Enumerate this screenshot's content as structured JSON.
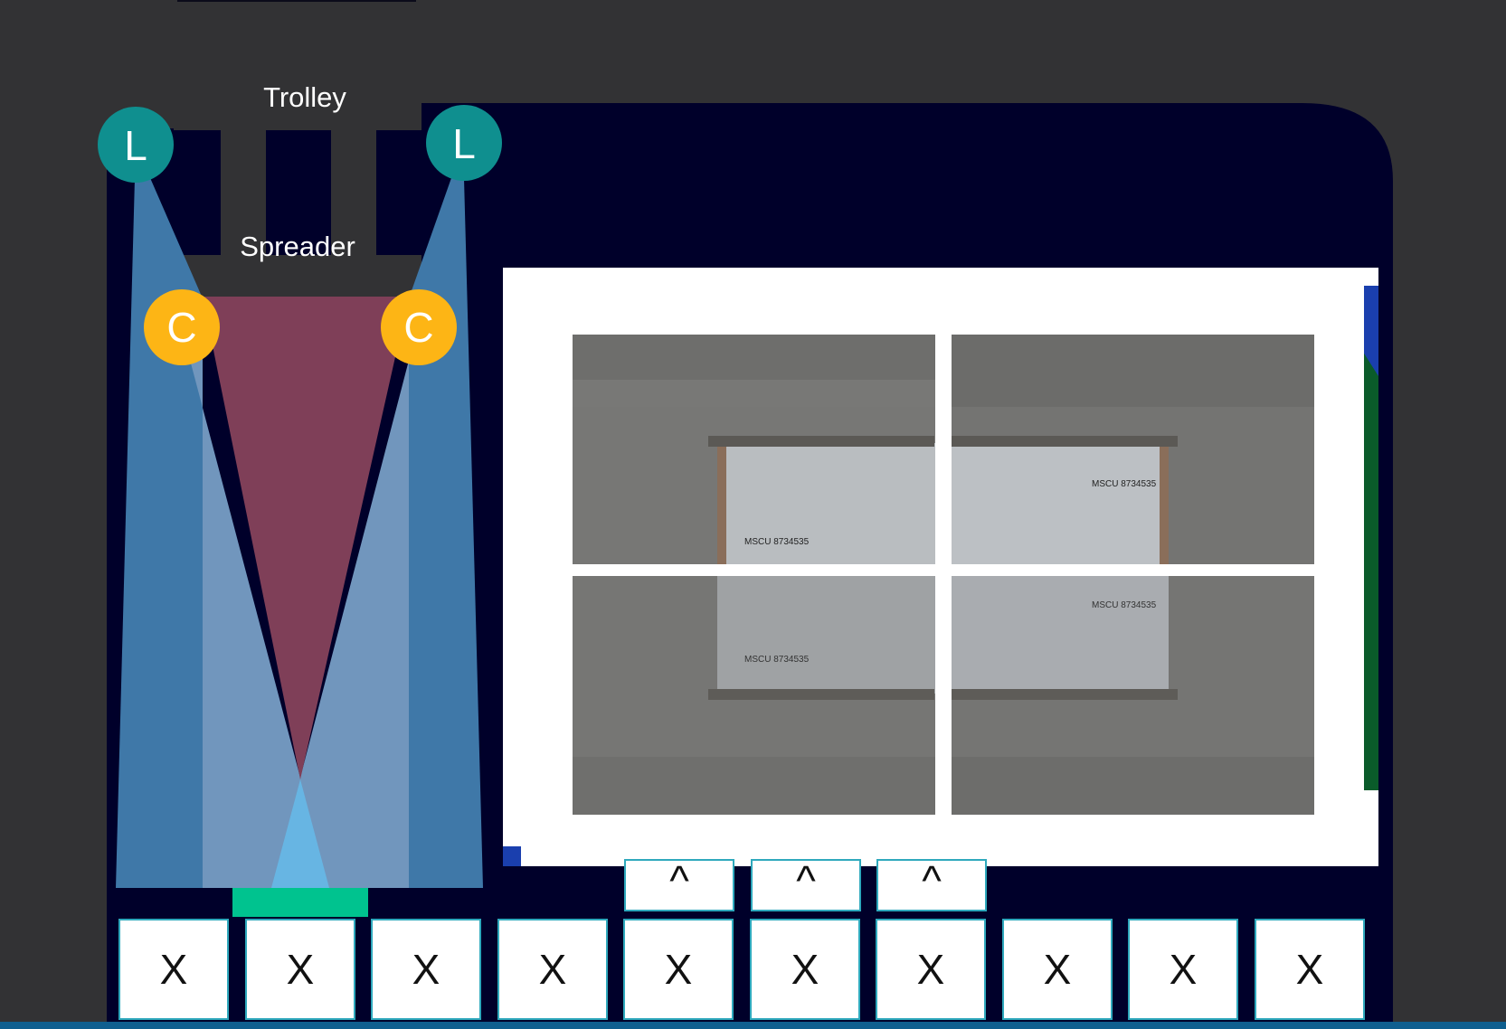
{
  "labels": {
    "trolley": "Trolley",
    "spreader": "Spreader",
    "lidar_left": "L",
    "lidar_right": "L",
    "camera_left": "C",
    "camera_right": "C"
  },
  "bottom_row": [
    "X",
    "X",
    "X",
    "X",
    "X",
    "X",
    "X",
    "X",
    "X",
    "X"
  ],
  "upper_row": [
    "^",
    "^",
    "^"
  ],
  "camera_feeds": {
    "count": 4,
    "container_codes": [
      "MSCU 8734535",
      "MSCU 8734535"
    ]
  },
  "colors": {
    "background": "#323234",
    "workspace": "#00002a",
    "lidar": "#0f8f8f",
    "camera": "#fdb515",
    "lidar_beam": "#3f78a8",
    "lidar_beam_inner": "#7196bd",
    "camera_view": "#7f3f58",
    "overlap": "#67b5e3",
    "target": "#00c38f",
    "box_border": "#2fa9bd"
  }
}
